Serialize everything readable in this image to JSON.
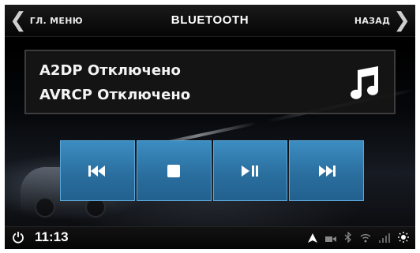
{
  "header": {
    "back_left_label": "ГЛ. МЕНЮ",
    "title": "BLUETOOTH",
    "back_right_label": "НАЗАД"
  },
  "info_panel": {
    "line1": "A2DP Отключено",
    "line2": "AVRCP Отключено",
    "icon": "music-note-icon"
  },
  "controls": [
    {
      "name": "previous-track-button",
      "icon": "skip-previous-icon"
    },
    {
      "name": "stop-button",
      "icon": "stop-icon"
    },
    {
      "name": "play-pause-button",
      "icon": "play-pause-icon"
    },
    {
      "name": "next-track-button",
      "icon": "skip-next-icon"
    }
  ],
  "statusbar": {
    "time": "11:13",
    "icons": [
      "navigation-arrow-icon",
      "camera-icon",
      "bluetooth-icon",
      "wifi-icon",
      "signal-icon",
      "brightness-icon"
    ]
  },
  "colors": {
    "accent_button": "#2f7bb0",
    "background": "#000000",
    "text": "#ffffff"
  }
}
